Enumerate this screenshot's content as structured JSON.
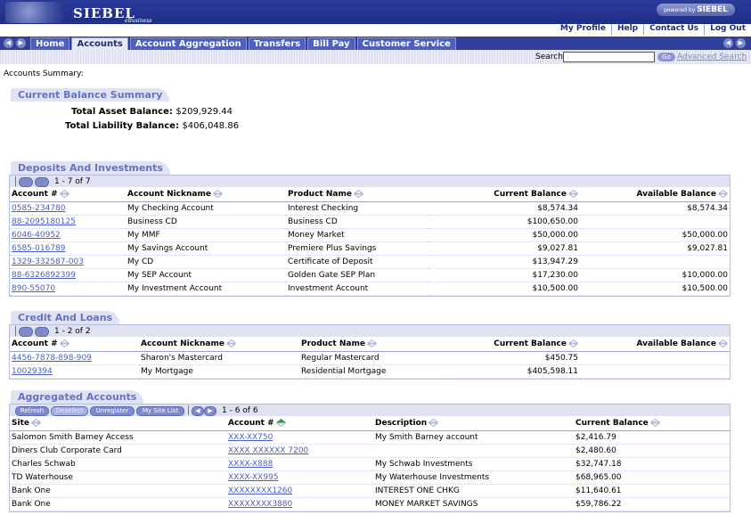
{
  "header": {
    "logo_text": "SIEBEL",
    "logo_sub": "eBusiness",
    "powered_prefix": "powered by",
    "powered_brand": "SIEBEL",
    "powered_sub": "eBusiness",
    "links": [
      "My Profile",
      "Help",
      "Contact Us",
      "Log Out"
    ]
  },
  "tabs": [
    {
      "label": "Home",
      "active": false
    },
    {
      "label": "Accounts",
      "active": true
    },
    {
      "label": "Account Aggregation",
      "active": false
    },
    {
      "label": "Transfers",
      "active": false
    },
    {
      "label": "Bill Pay",
      "active": false
    },
    {
      "label": "Customer Service",
      "active": false
    }
  ],
  "search": {
    "label": "Search:",
    "value": "",
    "go_label": "Go",
    "advanced_label": "Advanced Search"
  },
  "breadcrumb": "Accounts Summary:",
  "balance_summary": {
    "title": "Current Balance Summary",
    "asset_label": "Total Asset Balance:",
    "asset_value": "$209,929.44",
    "liability_label": "Total Liability Balance:",
    "liability_value": "$406,048.86"
  },
  "deposits": {
    "title": "Deposits And Investments",
    "paging": "1 - 7 of 7",
    "columns": [
      "Account #",
      "Account Nickname",
      "Product Name",
      "Current Balance",
      "Available Balance"
    ],
    "rows": [
      [
        "0585-234780",
        "My Checking Account",
        "Interest Checking",
        "$8,574.34",
        "$8,574.34"
      ],
      [
        "88-2095180125",
        "Business CD",
        "Business CD",
        "$100,650.00",
        ""
      ],
      [
        "6046-40952",
        "My MMF",
        "Money Market",
        "$50,000.00",
        "$50,000.00"
      ],
      [
        "6585-016789",
        "My Savings Account",
        "Premiere Plus Savings",
        "$9,027.81",
        "$9,027.81"
      ],
      [
        "1329-332587-003",
        "My CD",
        "Certificate of Deposit",
        "$13,947.29",
        ""
      ],
      [
        "88-6326892399",
        "My SEP Account",
        "Golden Gate SEP Plan",
        "$17,230.00",
        "$10,000.00"
      ],
      [
        "890-55070",
        "My Investment Account",
        "Investment Account",
        "$10,500.00",
        "$10,500.00"
      ]
    ]
  },
  "credit": {
    "title": "Credit And Loans",
    "paging": "1 - 2 of 2",
    "columns": [
      "Account #",
      "Account Nickname",
      "Product Name",
      "Current Balance",
      "Available Balance"
    ],
    "rows": [
      [
        "4456-7878-898-909",
        "Sharon's Mastercard",
        "Regular Mastercard",
        "$450.75",
        ""
      ],
      [
        "10029394",
        "My Mortgage",
        "Residential Mortgage",
        "$405,598.11",
        ""
      ]
    ]
  },
  "aggregated": {
    "title": "Aggregated Accounts",
    "buttons": [
      {
        "label": "Refresh",
        "enabled": true
      },
      {
        "label": "Deselect",
        "enabled": false
      },
      {
        "label": "Unregister",
        "enabled": true
      },
      {
        "label": "My Site List",
        "enabled": true
      }
    ],
    "paging": "1 - 6 of 6",
    "columns": [
      "Site",
      "Account #",
      "Description",
      "Current Balance"
    ],
    "rows": [
      [
        "Salomon Smith Barney Access",
        "XXX-XX750",
        "My Smith Barney account",
        "$2,416.79"
      ],
      [
        "Diners Club Corporate Card",
        "XXXX XXXXXX 7200",
        "",
        "$2,480.60"
      ],
      [
        "Charles Schwab",
        "XXXX-X888",
        "My Schwab Investments",
        "$32,747.18"
      ],
      [
        "TD Waterhouse",
        "XXXX-XX995",
        "My Waterhouse Investments",
        "$68,965.00"
      ],
      [
        "Bank One",
        "XXXXXXXX1260",
        "INTEREST ONE CHKG",
        "$11,640.61"
      ],
      [
        "Bank One",
        "XXXXXXXX3880",
        "MONEY MARKET SAVINGS",
        "$59,786.22"
      ]
    ]
  },
  "colors": {
    "brand": "#1f2f85",
    "link": "#4a5fc7",
    "section": "#dfe2f3",
    "accent_sort": "#2e9e3e"
  }
}
